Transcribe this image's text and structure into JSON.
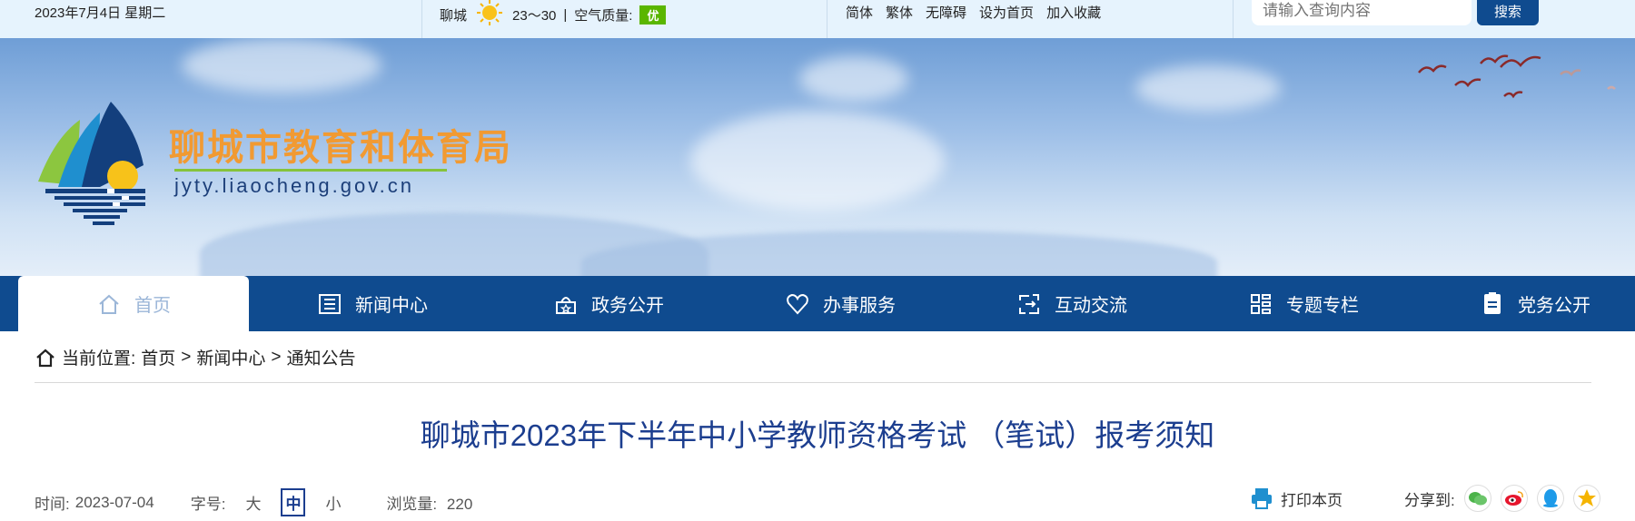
{
  "topbar": {
    "date": "2023年7月4日 星期二",
    "city": "聊城",
    "temperature": "23～30",
    "divider": "|",
    "air_label": "空气质量:",
    "air_value": "优",
    "links": [
      "简体",
      "繁体",
      "无障碍",
      "设为首页",
      "加入收藏"
    ],
    "search_placeholder": "请输入查询内容",
    "search_button": "搜索"
  },
  "header": {
    "site_name": "聊城市教育和体育局",
    "site_url": "jyty.liaocheng.gov.cn"
  },
  "nav": [
    {
      "label": "首页",
      "icon": "home-icon",
      "active": true
    },
    {
      "label": "新闻中心",
      "icon": "news-icon",
      "active": false
    },
    {
      "label": "政务公开",
      "icon": "gov-affairs-icon",
      "active": false
    },
    {
      "label": "办事服务",
      "icon": "heart-icon",
      "active": false
    },
    {
      "label": "互动交流",
      "icon": "interaction-icon",
      "active": false
    },
    {
      "label": "专题专栏",
      "icon": "grid-icon",
      "active": false
    },
    {
      "label": "党务公开",
      "icon": "party-affairs-icon",
      "active": false
    }
  ],
  "breadcrumb": {
    "label": "当前位置:",
    "items": [
      "首页",
      "新闻中心",
      "通知公告"
    ],
    "separator": ">"
  },
  "article": {
    "title": "聊城市2023年下半年中小学教师资格考试 （笔试）报考须知",
    "time_label": "时间:",
    "time_value": "2023-07-04",
    "font_label": "字号:",
    "font_sizes": [
      "大",
      "中",
      "小"
    ],
    "selected_font": "中",
    "views_label": "浏览量:",
    "views_value": "220",
    "print_label": "打印本页",
    "share_label": "分享到:"
  },
  "colors": {
    "primary": "#0f4b8f",
    "title_blue": "#1c3e8f",
    "site_name_orange": "#f19a32",
    "air_good_green": "#5ab600"
  }
}
